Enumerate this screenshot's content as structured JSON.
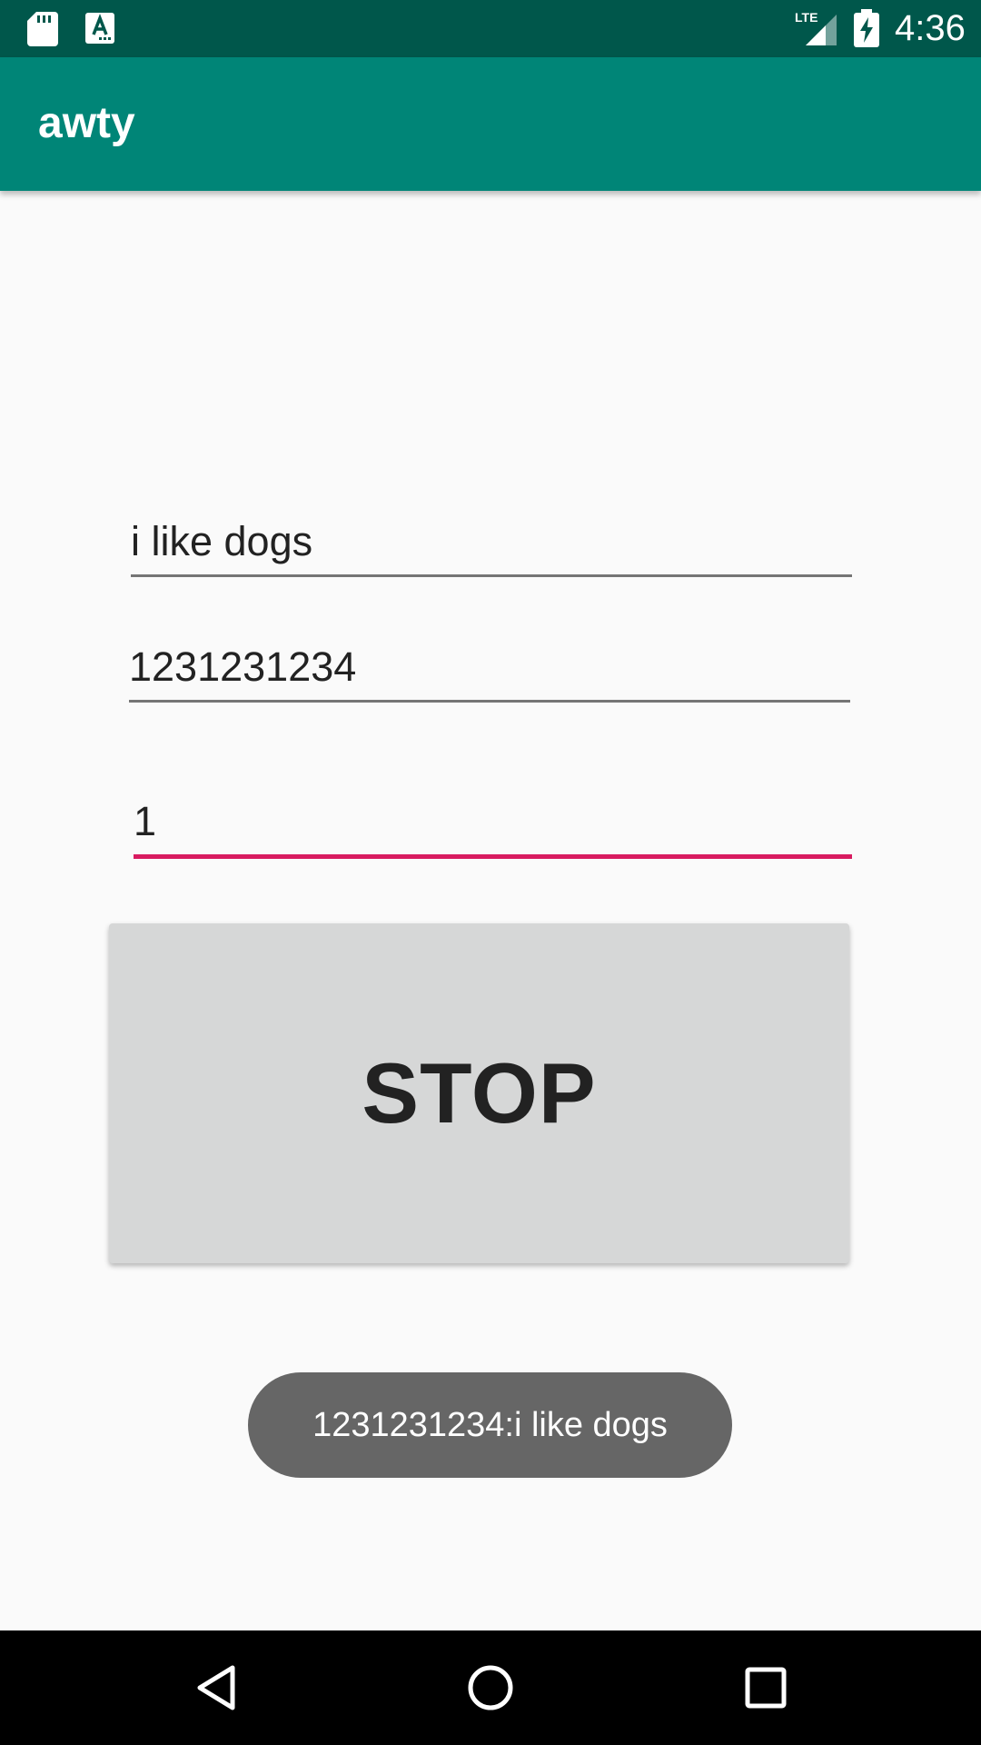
{
  "status_bar": {
    "time": "4:36",
    "icons": [
      "sd-card-icon",
      "text-a-icon",
      "lte-signal-icon",
      "battery-charging-icon"
    ],
    "network_label": "LTE"
  },
  "app_bar": {
    "title": "awty",
    "color": "#008577",
    "status_color": "#00574b"
  },
  "form": {
    "message": "i like dogs",
    "phone": "1231231234",
    "minutes": "1",
    "focus_color": "#d81b60"
  },
  "button": {
    "label": "STOP"
  },
  "toast": {
    "text": "1231231234:i like dogs"
  },
  "nav_bar": {
    "icons": [
      "back-icon",
      "home-icon",
      "recents-icon"
    ]
  }
}
